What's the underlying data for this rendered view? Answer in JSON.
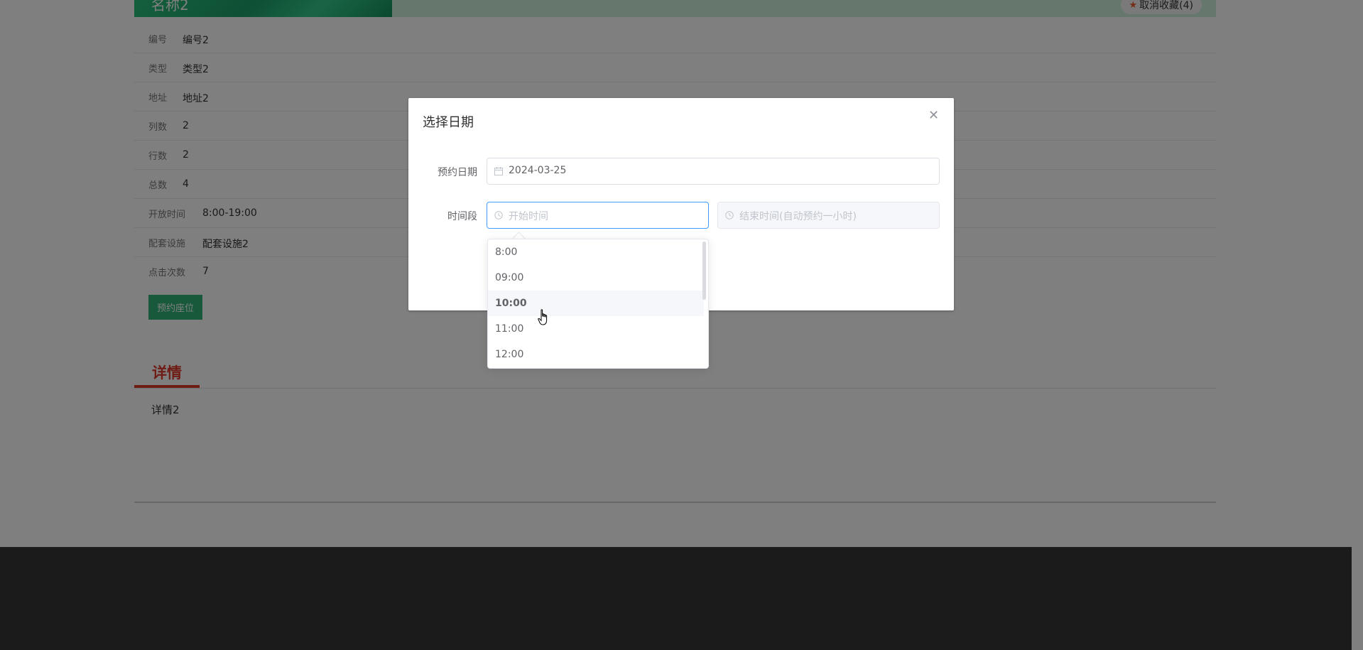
{
  "banner": {
    "title": "名称2",
    "favorite_label": "取消收藏(4)",
    "favorite_icon": "star-icon"
  },
  "info_rows": [
    {
      "label": "编号",
      "value": "编号2"
    },
    {
      "label": "类型",
      "value": "类型2"
    },
    {
      "label": "地址",
      "value": "地址2"
    },
    {
      "label": "列数",
      "value": "2"
    },
    {
      "label": "行数",
      "value": "2"
    },
    {
      "label": "总数",
      "value": "4"
    },
    {
      "label": "开放时间",
      "value": "8:00-19:00"
    },
    {
      "label": "配套设施",
      "value": "配套设施2"
    },
    {
      "label": "点击次数",
      "value": "7"
    }
  ],
  "book_button": "预约座位",
  "detail": {
    "tab": "详情",
    "content": "详情2"
  },
  "dialog": {
    "title": "选择日期",
    "date_label": "预约日期",
    "date_value": "2024-03-25",
    "time_label": "时间段",
    "start_placeholder": "开始时间",
    "end_placeholder": "结束时间(自动预约一小时)"
  },
  "time_options": [
    "8:00",
    "09:00",
    "10:00",
    "11:00",
    "12:00"
  ],
  "hovered_option": "10:00",
  "colors": {
    "primary": "#409eff",
    "accent": "#2fb275",
    "detail_red": "#e0392c"
  }
}
